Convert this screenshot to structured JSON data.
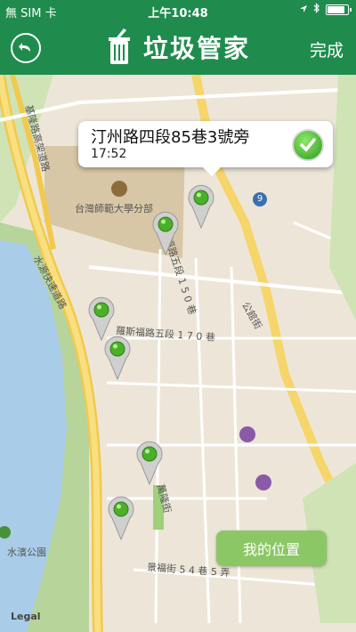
{
  "status": {
    "carrier": "無 SIM 卡",
    "time": "上午10:48",
    "battery_level": 0.85
  },
  "header": {
    "back_label": "back",
    "title": "垃圾管家",
    "done_label": "完成"
  },
  "callout": {
    "address": "汀州路四段85巷3號旁",
    "time": "17:52"
  },
  "map": {
    "labels": {
      "university": "台灣師範大學分部",
      "road_5_170": "羅斯福路五段 1 7 0 巷",
      "road_5_150": "羅斯福路五段 1 5 0 巷",
      "gongguan": "公館街",
      "expressway": "水源快速道路",
      "jilong": "基隆路高架道路",
      "jingfu_54": "景福街 5 4 巷 5 弄",
      "jingfu": "景福街",
      "park": "水濱公園",
      "road_no": "9",
      "wanlong": "萬隆街"
    },
    "legal": "Legal"
  },
  "my_location_label": "我的位置",
  "colors": {
    "accent": "#1f8c4e",
    "button": "#8cc765"
  },
  "icons": [
    "back-icon",
    "trash-can-icon",
    "check-icon",
    "map-pin-icon",
    "location-arrow-icon",
    "bluetooth-icon",
    "wifi-icon",
    "battery-icon"
  ]
}
